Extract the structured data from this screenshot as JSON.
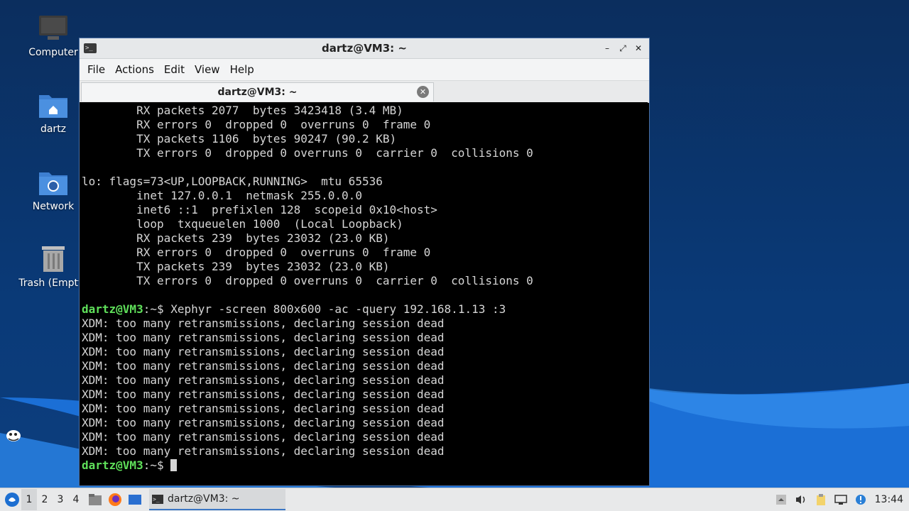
{
  "desktop": {
    "icons": [
      {
        "label": "Computer",
        "icon": "computer-icon"
      },
      {
        "label": "dartz",
        "icon": "home-folder-icon"
      },
      {
        "label": "Network",
        "icon": "network-folder-icon"
      },
      {
        "label": "Trash (Empty)",
        "icon": "trash-icon"
      }
    ]
  },
  "window": {
    "title": "dartz@VM3: ~",
    "menu": [
      "File",
      "Actions",
      "Edit",
      "View",
      "Help"
    ],
    "tab_label": "dartz@VM3: ~",
    "wm_buttons": {
      "minimize": "–",
      "maximize": "⤢",
      "close": "✕"
    }
  },
  "terminal": {
    "lines": [
      "        RX packets 2077  bytes 3423418 (3.4 MB)",
      "        RX errors 0  dropped 0  overruns 0  frame 0",
      "        TX packets 1106  bytes 90247 (90.2 KB)",
      "        TX errors 0  dropped 0 overruns 0  carrier 0  collisions 0",
      "",
      "lo: flags=73<UP,LOOPBACK,RUNNING>  mtu 65536",
      "        inet 127.0.0.1  netmask 255.0.0.0",
      "        inet6 ::1  prefixlen 128  scopeid 0x10<host>",
      "        loop  txqueuelen 1000  (Local Loopback)",
      "        RX packets 239  bytes 23032 (23.0 KB)",
      "        RX errors 0  dropped 0  overruns 0  frame 0",
      "        TX packets 239  bytes 23032 (23.0 KB)",
      "        TX errors 0  dropped 0 overruns 0  carrier 0  collisions 0",
      ""
    ],
    "prompt_user": "dartz@VM3",
    "prompt_path": ":~$ ",
    "command": "Xephyr -screen 800x600 -ac -query 192.168.1.13 :3",
    "output": [
      "XDM: too many retransmissions, declaring session dead",
      "XDM: too many retransmissions, declaring session dead",
      "XDM: too many retransmissions, declaring session dead",
      "XDM: too many retransmissions, declaring session dead",
      "XDM: too many retransmissions, declaring session dead",
      "XDM: too many retransmissions, declaring session dead",
      "XDM: too many retransmissions, declaring session dead",
      "XDM: too many retransmissions, declaring session dead",
      "XDM: too many retransmissions, declaring session dead",
      "XDM: too many retransmissions, declaring session dead"
    ]
  },
  "taskbar": {
    "workspaces": [
      "1",
      "2",
      "3",
      "4"
    ],
    "active_workspace": "1",
    "task_label": "dartz@VM3: ~",
    "clock": "13:44"
  },
  "colors": {
    "prompt": "#5fe05a",
    "terminal_bg": "#000000",
    "terminal_fg": "#d6d6d6",
    "desktop_bg": "#0b2e5e"
  }
}
